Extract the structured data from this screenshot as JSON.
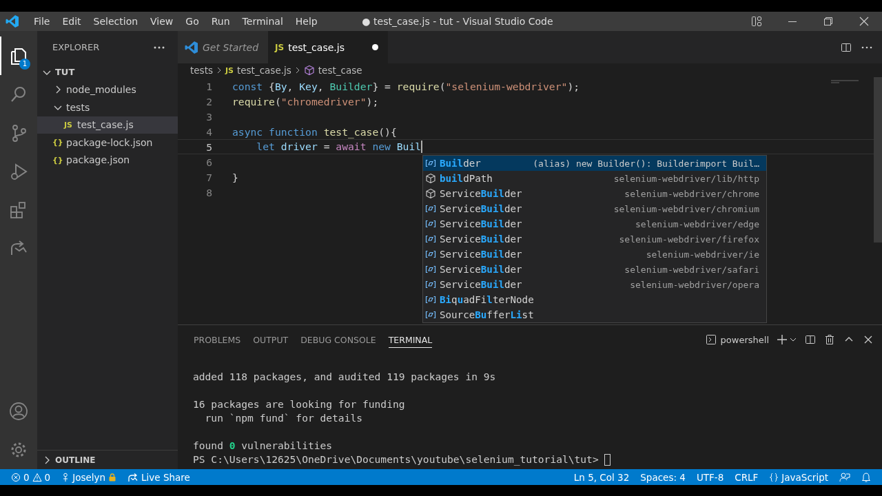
{
  "window": {
    "title": "● test_case.js - tut - Visual Studio Code"
  },
  "menu": [
    "File",
    "Edit",
    "Selection",
    "View",
    "Go",
    "Run",
    "Terminal",
    "Help"
  ],
  "activity_bar": [
    {
      "kind": "explorer",
      "selected": true,
      "badge": "1"
    },
    {
      "kind": "search",
      "selected": false
    },
    {
      "kind": "source-control",
      "selected": false
    },
    {
      "kind": "run",
      "selected": false
    },
    {
      "kind": "extensions",
      "selected": false
    },
    {
      "kind": "live-share",
      "selected": false
    }
  ],
  "sidebar": {
    "title": "EXPLORER",
    "tree": [
      {
        "label": "TUT",
        "kind": "root",
        "expanded": true,
        "selected": false,
        "children": [
          {
            "label": "node_modules",
            "kind": "folder",
            "expanded": false,
            "selected": false
          },
          {
            "label": "tests",
            "kind": "folder",
            "expanded": true,
            "selected": false,
            "children": [
              {
                "label": "test_case.js",
                "kind": "js",
                "icon": "JS",
                "selected": true
              }
            ]
          },
          {
            "label": "package-lock.json",
            "kind": "json",
            "icon": "{}",
            "selected": false
          },
          {
            "label": "package.json",
            "kind": "json",
            "icon": "{}",
            "selected": false
          }
        ]
      }
    ],
    "outline": {
      "label": "OUTLINE",
      "expanded": false
    }
  },
  "tabs": [
    {
      "label": "Get Started",
      "kind": "welcome",
      "preview": true,
      "modified": false,
      "selected": false
    },
    {
      "label": "test_case.js",
      "kind": "js",
      "icon": "JS",
      "preview": false,
      "modified": true,
      "selected": true
    }
  ],
  "breadcrumb": [
    {
      "label": "tests",
      "kind": "folder"
    },
    {
      "label": "test_case.js",
      "kind": "js",
      "icon": "JS"
    },
    {
      "label": "test_case",
      "kind": "function"
    }
  ],
  "editor": {
    "lines": [
      {
        "number": "1",
        "current": false,
        "tokens": [
          {
            "text": "const ",
            "kind": "keyword"
          },
          {
            "text": "{",
            "kind": "punct"
          },
          {
            "text": "By",
            "kind": "var"
          },
          {
            "text": ", ",
            "kind": "punct"
          },
          {
            "text": "Key",
            "kind": "var"
          },
          {
            "text": ", ",
            "kind": "punct"
          },
          {
            "text": "Builder",
            "kind": "class"
          },
          {
            "text": "} = ",
            "kind": "punct"
          },
          {
            "text": "require",
            "kind": "func"
          },
          {
            "text": "(",
            "kind": "punct"
          },
          {
            "text": "\"selenium-webdriver\"",
            "kind": "string"
          },
          {
            "text": ");",
            "kind": "punct"
          }
        ]
      },
      {
        "number": "2",
        "current": false,
        "tokens": [
          {
            "text": "require",
            "kind": "func"
          },
          {
            "text": "(",
            "kind": "punct"
          },
          {
            "text": "\"chromedriver\"",
            "kind": "string"
          },
          {
            "text": ");",
            "kind": "punct"
          }
        ]
      },
      {
        "number": "3",
        "current": false
      },
      {
        "number": "4",
        "current": false,
        "tokens": [
          {
            "text": "async function ",
            "kind": "keyword"
          },
          {
            "text": "test_case",
            "kind": "func"
          },
          {
            "text": "(){",
            "kind": "punct"
          }
        ]
      },
      {
        "number": "5",
        "current": true,
        "tokens": [
          {
            "text": "    let ",
            "kind": "keyword"
          },
          {
            "text": "driver",
            "kind": "var"
          },
          {
            "text": " = ",
            "kind": "punct"
          },
          {
            "text": "await ",
            "kind": "control"
          },
          {
            "text": "new ",
            "kind": "keyword"
          },
          {
            "text": "Buil",
            "kind": "var"
          }
        ]
      },
      {
        "number": "6",
        "current": false
      },
      {
        "number": "7",
        "current": false,
        "tokens": [
          {
            "text": "}",
            "kind": "punct"
          }
        ]
      },
      {
        "number": "8",
        "current": false
      }
    ]
  },
  "suggestions": [
    {
      "kind": "variable",
      "selected": true,
      "parts": [
        {
          "text": "Buil",
          "kind": "match"
        },
        {
          "text": "der",
          "kind": "plain"
        }
      ],
      "detail": "(alias) new Builder(): Builderimport Buil…"
    },
    {
      "kind": "module",
      "selected": false,
      "parts": [
        {
          "text": "buil",
          "kind": "match"
        },
        {
          "text": "dPath",
          "kind": "plain"
        }
      ],
      "detail": "selenium-webdriver/lib/http"
    },
    {
      "kind": "module",
      "selected": false,
      "parts": [
        {
          "text": "Service",
          "kind": "plain"
        },
        {
          "text": "Buil",
          "kind": "match"
        },
        {
          "text": "der",
          "kind": "plain"
        }
      ],
      "detail": "selenium-webdriver/chrome"
    },
    {
      "kind": "variable",
      "selected": false,
      "parts": [
        {
          "text": "Service",
          "kind": "plain"
        },
        {
          "text": "Buil",
          "kind": "match"
        },
        {
          "text": "der",
          "kind": "plain"
        }
      ],
      "detail": "selenium-webdriver/chromium"
    },
    {
      "kind": "variable",
      "selected": false,
      "parts": [
        {
          "text": "Service",
          "kind": "plain"
        },
        {
          "text": "Buil",
          "kind": "match"
        },
        {
          "text": "der",
          "kind": "plain"
        }
      ],
      "detail": "selenium-webdriver/edge"
    },
    {
      "kind": "variable",
      "selected": false,
      "parts": [
        {
          "text": "Service",
          "kind": "plain"
        },
        {
          "text": "Buil",
          "kind": "match"
        },
        {
          "text": "der",
          "kind": "plain"
        }
      ],
      "detail": "selenium-webdriver/firefox"
    },
    {
      "kind": "variable",
      "selected": false,
      "parts": [
        {
          "text": "Service",
          "kind": "plain"
        },
        {
          "text": "Buil",
          "kind": "match"
        },
        {
          "text": "der",
          "kind": "plain"
        }
      ],
      "detail": "selenium-webdriver/ie"
    },
    {
      "kind": "variable",
      "selected": false,
      "parts": [
        {
          "text": "Service",
          "kind": "plain"
        },
        {
          "text": "Buil",
          "kind": "match"
        },
        {
          "text": "der",
          "kind": "plain"
        }
      ],
      "detail": "selenium-webdriver/safari"
    },
    {
      "kind": "variable",
      "selected": false,
      "parts": [
        {
          "text": "Service",
          "kind": "plain"
        },
        {
          "text": "Buil",
          "kind": "match"
        },
        {
          "text": "der",
          "kind": "plain"
        }
      ],
      "detail": "selenium-webdriver/opera"
    },
    {
      "kind": "variable",
      "selected": false,
      "parts": [
        {
          "text": "Bi",
          "kind": "match"
        },
        {
          "text": "q",
          "kind": "plain"
        },
        {
          "text": "u",
          "kind": "match"
        },
        {
          "text": "adFi",
          "kind": "plain"
        },
        {
          "text": "l",
          "kind": "match"
        },
        {
          "text": "terNode",
          "kind": "plain"
        }
      ]
    },
    {
      "kind": "variable",
      "selected": false,
      "parts": [
        {
          "text": "Source",
          "kind": "plain"
        },
        {
          "text": "Bu",
          "kind": "match"
        },
        {
          "text": "ffer",
          "kind": "plain"
        },
        {
          "text": "Li",
          "kind": "match"
        },
        {
          "text": "st",
          "kind": "plain"
        }
      ]
    }
  ],
  "panel": {
    "tabs": [
      {
        "label": "PROBLEMS",
        "selected": false
      },
      {
        "label": "OUTPUT",
        "selected": false
      },
      {
        "label": "DEBUG CONSOLE",
        "selected": false
      },
      {
        "label": "TERMINAL",
        "selected": true
      }
    ],
    "shell": "powershell",
    "terminal": [
      {
        "kind": "blank"
      },
      {
        "kind": "output",
        "segments": [
          {
            "text": "added 118 packages, and audited 119 packages in 9s",
            "kind": "plain"
          }
        ]
      },
      {
        "kind": "blank"
      },
      {
        "kind": "output",
        "segments": [
          {
            "text": "16 packages are looking for funding",
            "kind": "plain"
          }
        ]
      },
      {
        "kind": "output",
        "segments": [
          {
            "text": "  run `npm fund` for details",
            "kind": "plain"
          }
        ]
      },
      {
        "kind": "blank"
      },
      {
        "kind": "output",
        "segments": [
          {
            "text": "found ",
            "kind": "plain"
          },
          {
            "text": "0",
            "kind": "success"
          },
          {
            "text": " vulnerabilities",
            "kind": "plain"
          }
        ]
      },
      {
        "kind": "output",
        "segments": [
          {
            "text": "PS C:\\Users\\12625\\OneDrive\\Documents\\youtube\\selenium_tutorial\\tut> ",
            "kind": "plain"
          }
        ],
        "cursor": true
      }
    ]
  },
  "status_bar": {
    "left": [
      {
        "kind": "problems",
        "errors": "0",
        "warnings": "0"
      },
      {
        "kind": "account",
        "label": "Joselyn"
      },
      {
        "kind": "live-share",
        "label": "Live Share"
      }
    ],
    "right": [
      {
        "kind": "text",
        "label": "Ln 5, Col 32"
      },
      {
        "kind": "text",
        "label": "Spaces: 4"
      },
      {
        "kind": "text",
        "label": "UTF-8"
      },
      {
        "kind": "text",
        "label": "CRLF"
      },
      {
        "kind": "language",
        "label": "JavaScript"
      },
      {
        "kind": "feedback"
      },
      {
        "kind": "bell"
      }
    ]
  }
}
